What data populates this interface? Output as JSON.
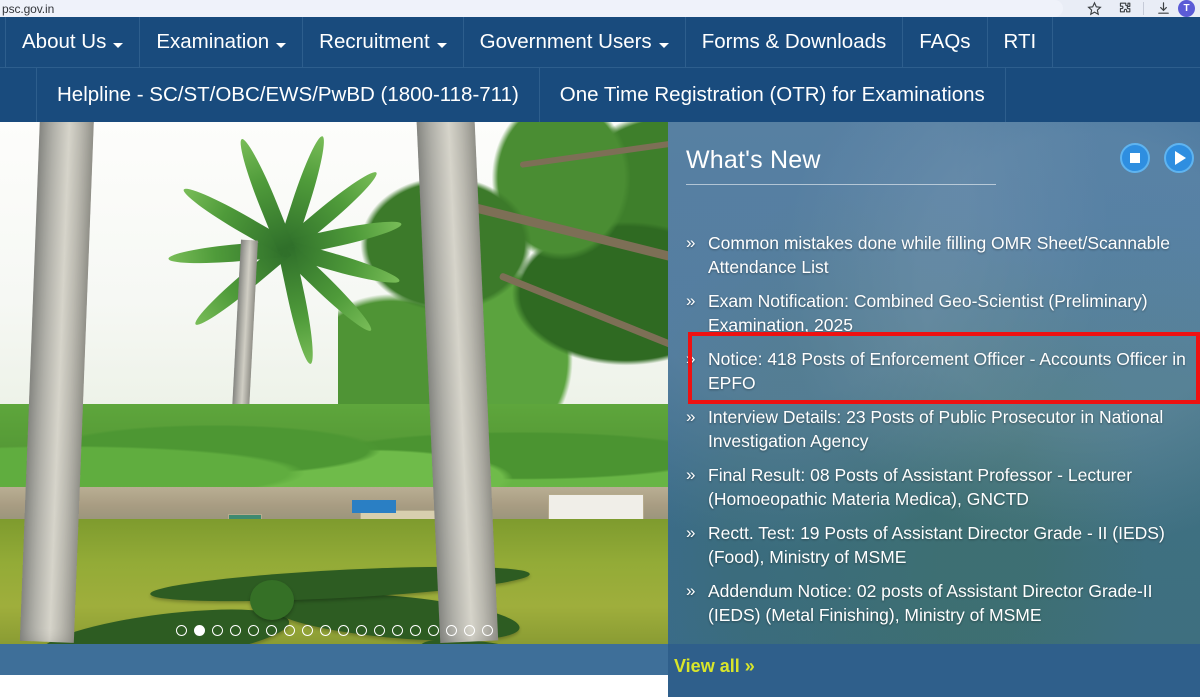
{
  "browser": {
    "url": "psc.gov.in",
    "icons": [
      {
        "name": "bookmark-star-icon"
      },
      {
        "name": "extensions-puzzle-icon"
      },
      {
        "name": "downloads-icon"
      }
    ],
    "profile_initial": "T"
  },
  "nav": {
    "items": [
      {
        "label": "About Us",
        "has_dropdown": true
      },
      {
        "label": "Examination",
        "has_dropdown": true
      },
      {
        "label": "Recruitment",
        "has_dropdown": true
      },
      {
        "label": "Government Users",
        "has_dropdown": true
      },
      {
        "label": "Forms & Downloads",
        "has_dropdown": false
      },
      {
        "label": "FAQs",
        "has_dropdown": false
      },
      {
        "label": "RTI",
        "has_dropdown": false
      }
    ]
  },
  "subnav": {
    "items": [
      {
        "label": "Helpline - SC/ST/OBC/EWS/PwBD (1800-118-711)"
      },
      {
        "label": "One Time Registration (OTR) for Examinations"
      }
    ]
  },
  "carousel": {
    "slide_count": 18,
    "active_index": 1,
    "alt": "UPSC campus garden with palm trees and hedge topiary spelling UPSC"
  },
  "whats_new": {
    "title": "What's New",
    "stop_label": "stop",
    "play_label": "play",
    "view_all": "View all »",
    "bullet": "»",
    "items": [
      {
        "text": "Common mistakes done while filling OMR Sheet/Scannable Attendance List",
        "highlighted": false
      },
      {
        "text": "Exam Notification: Combined Geo-Scientist (Preliminary) Examination, 2025",
        "highlighted": true
      },
      {
        "text": "Notice: 418 Posts of Enforcement Officer - Accounts Officer in EPFO",
        "highlighted": false
      },
      {
        "text": "Interview Details: 23 Posts of Public Prosecutor in National Investigation Agency",
        "highlighted": false
      },
      {
        "text": "Final Result: 08 Posts of Assistant Professor - Lecturer (Homoeopathic Materia Medica), GNCTD",
        "highlighted": false
      },
      {
        "text": "Rectt. Test: 19 Posts of Assistant Director Grade - II (IEDS) (Food), Ministry of MSME",
        "highlighted": false
      },
      {
        "text": "Addendum Notice: 02 posts of Assistant Director Grade-II (IEDS) (Metal Finishing), Ministry of MSME",
        "highlighted": false
      }
    ]
  },
  "colors": {
    "nav_blue": "#194b7d",
    "panel_blue": "#3e6f99",
    "highlight_red": "#ee1111",
    "view_all_yellow": "#d9e62a",
    "control_blue": "#2e8ee0"
  }
}
